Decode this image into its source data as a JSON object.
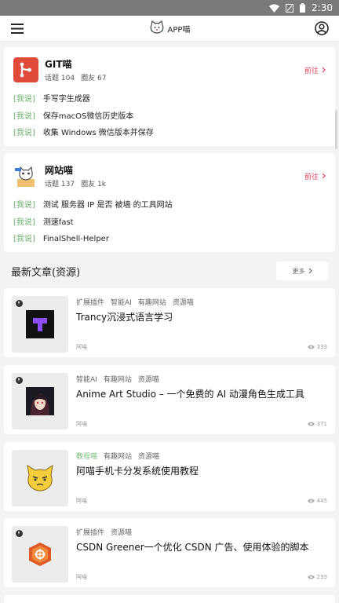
{
  "status_bar": {
    "time": "2:30"
  },
  "app_bar": {
    "title": "APP喵"
  },
  "circles": [
    {
      "name": "GIT喵",
      "topics_label": "话题",
      "topics": "104",
      "friends_label": "圈友",
      "friends": "67",
      "goto": "前往",
      "posts": [
        {
          "tag": "[我说]",
          "text": "手写字生成器"
        },
        {
          "tag": "[我说]",
          "text": "保存macOS微信历史版本"
        },
        {
          "tag": "[我说]",
          "text": "收集 Windows 微信版本并保存"
        }
      ]
    },
    {
      "name": "网站喵",
      "topics_label": "话题",
      "topics": "137",
      "friends_label": "圈友",
      "friends": "1k",
      "goto": "前往",
      "posts": [
        {
          "tag": "[我说]",
          "text": "测试 服务器 IP 是否 被墙 的工具网站"
        },
        {
          "tag": "[我说]",
          "text": "测速fast"
        },
        {
          "tag": "[我说]",
          "text": "FinalShell-Helper"
        }
      ]
    }
  ],
  "latest": {
    "title": "最新文章(资源)",
    "more": "更多"
  },
  "articles": [
    {
      "tags": [
        "扩展插件",
        "智能AI",
        "有趣网站",
        "资源喵"
      ],
      "title": "Trancy沉浸式语言学习",
      "author": "阿喵",
      "views": "333"
    },
    {
      "tags": [
        "智能AI",
        "有趣网站",
        "资源喵"
      ],
      "title": "Anime Art Studio – 一个免费的 AI 动漫角色生成工具",
      "author": "阿喵",
      "views": "371"
    },
    {
      "tags": [
        "教程喵",
        "有趣网站",
        "资源喵"
      ],
      "title": "阿喵手机卡分发系统使用教程",
      "author": "阿喵",
      "views": "445"
    },
    {
      "tags": [
        "扩展插件",
        "资源喵"
      ],
      "title": "CSDN Greener一个优化 CSDN 广告、使用体验的脚本",
      "author": "阿喵",
      "views": "233"
    }
  ],
  "colors": {
    "accent": "#e0405f",
    "tag_green": "#6bb26b",
    "git_red": "#e04a3a"
  }
}
